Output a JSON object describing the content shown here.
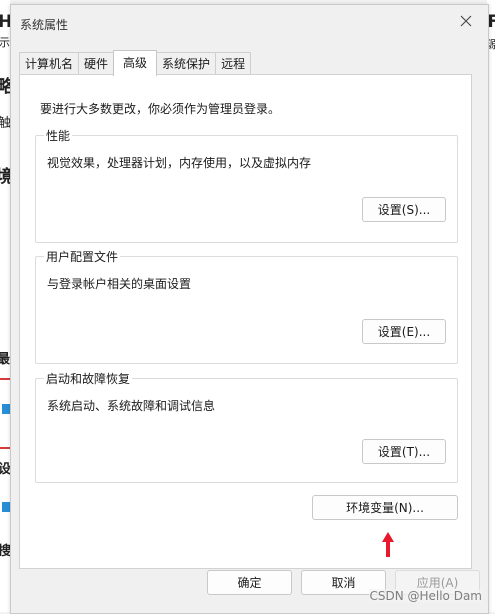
{
  "background": {
    "fragments": [
      "H",
      "示",
      "略",
      "触",
      "境",
      "最",
      "设",
      "搜"
    ],
    "right_fragments": [
      "F",
      "源"
    ]
  },
  "dialog": {
    "title": "系统属性",
    "tabs": [
      {
        "label": "计算机名"
      },
      {
        "label": "硬件"
      },
      {
        "label": "高级"
      },
      {
        "label": "系统保护"
      },
      {
        "label": "远程"
      }
    ],
    "active_tab": "高级",
    "intro": "要进行大多数更改，你必须作为管理员登录。",
    "groups": {
      "performance": {
        "label": "性能",
        "description": "视觉效果，处理器计划，内存使用，以及虚拟内存",
        "button": "设置(S)..."
      },
      "user_profiles": {
        "label": "用户配置文件",
        "description": "与登录帐户相关的桌面设置",
        "button": "设置(E)..."
      },
      "startup_recovery": {
        "label": "启动和故障恢复",
        "description": "系统启动、系统故障和调试信息",
        "button": "设置(T)..."
      }
    },
    "env_button": "环境变量(N)...",
    "footer": {
      "ok": "确定",
      "cancel": "取消",
      "apply": "应用(A)"
    }
  },
  "watermark": "CSDN @Hello Dam",
  "colors": {
    "annotation_arrow": "#e8192c",
    "accent_line": "#d63b3b",
    "blue_block": "#2a8ed6"
  }
}
